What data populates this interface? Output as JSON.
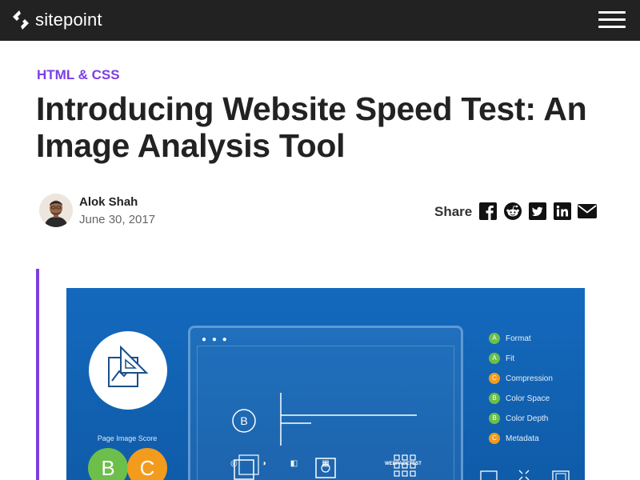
{
  "header": {
    "logo_text": "sitepoint",
    "menu_icon": "hamburger-menu-icon"
  },
  "article": {
    "category": "HTML & CSS",
    "title": "Introducing Website Speed Test: An Image Analysis Tool",
    "author": "Alok Shah",
    "date": "June 30, 2017"
  },
  "share": {
    "label": "Share",
    "icons": [
      "facebook-icon",
      "reddit-icon",
      "twitter-icon",
      "linkedin-icon",
      "email-icon"
    ]
  },
  "hero": {
    "score_label": "Page Image Score",
    "grades": [
      "B",
      "C"
    ],
    "browser_badge": "B",
    "browser_footer_text": "WEBPAGETEST",
    "features": [
      {
        "grade": "A",
        "label": "Format",
        "color": "#6cbf4a"
      },
      {
        "grade": "A",
        "label": "Fit",
        "color": "#6cbf4a"
      },
      {
        "grade": "C",
        "label": "Compression",
        "color": "#f39b1d"
      },
      {
        "grade": "B",
        "label": "Color Space",
        "color": "#6cbf4a"
      },
      {
        "grade": "B",
        "label": "Color Depth",
        "color": "#6cbf4a"
      },
      {
        "grade": "C",
        "label": "Metadata",
        "color": "#f39b1d"
      }
    ]
  },
  "colors": {
    "accent": "#7b3fe4",
    "topbar": "#222222",
    "hero_blue": "#1469bd",
    "grade_green": "#6cbf4a",
    "grade_orange": "#f39b1d"
  }
}
